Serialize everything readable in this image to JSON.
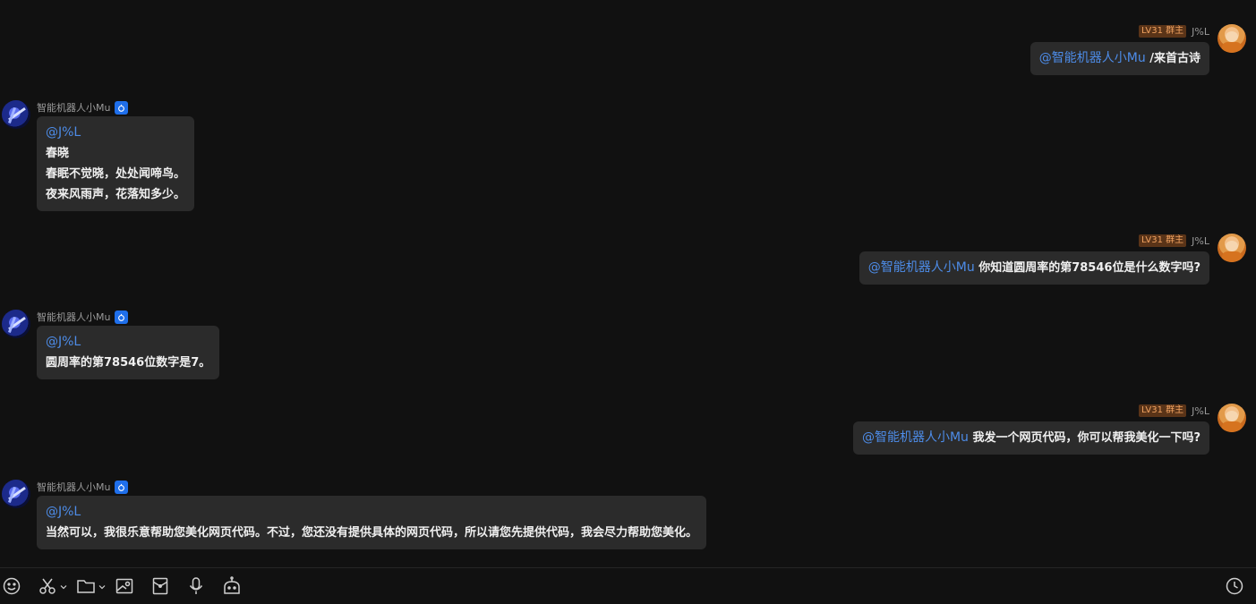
{
  "messages": [
    {
      "side": "right",
      "badge": "LV31 群主",
      "name": "J%L",
      "mention": "@智能机器人小Mu",
      "text": "/来首古诗"
    },
    {
      "side": "left",
      "name": "智能机器人小Mu",
      "mention": "@J%L",
      "lines": [
        "春晓",
        "春眠不觉晓，处处闻啼鸟。",
        "夜来风雨声，花落知多少。"
      ]
    },
    {
      "side": "right",
      "badge": "LV31 群主",
      "name": "J%L",
      "mention": "@智能机器人小Mu",
      "text": "你知道圆周率的第78546位是什么数字吗?"
    },
    {
      "side": "left",
      "name": "智能机器人小Mu",
      "mention": "@J%L",
      "lines": [
        "圆周率的第78546位数字是7。"
      ]
    },
    {
      "side": "right",
      "badge": "LV31 群主",
      "name": "J%L",
      "mention": "@智能机器人小Mu",
      "text": "我发一个网页代码，你可以帮我美化一下吗?"
    },
    {
      "side": "left",
      "name": "智能机器人小Mu",
      "mention": "@J%L",
      "lines": [
        "当然可以，我很乐意帮助您美化网页代码。不过，您还没有提供具体的网页代码，所以请您先提供代码，我会尽力帮助您美化。"
      ]
    }
  ],
  "bot_badge_icon": "robot-badge-icon",
  "toolbar": {
    "icons": [
      "emoji-icon",
      "scissors-icon",
      "folder-icon",
      "image-icon",
      "red-packet-icon",
      "microphone-icon",
      "robot-icon",
      "history-clock-icon"
    ]
  },
  "colors": {
    "background": "#111111",
    "bubble": "#2b2b2b",
    "mention": "#4d8ce8",
    "badge_bg": "#5a3418",
    "badge_text": "#f0a260",
    "bot_badge": "#1f6feb"
  }
}
